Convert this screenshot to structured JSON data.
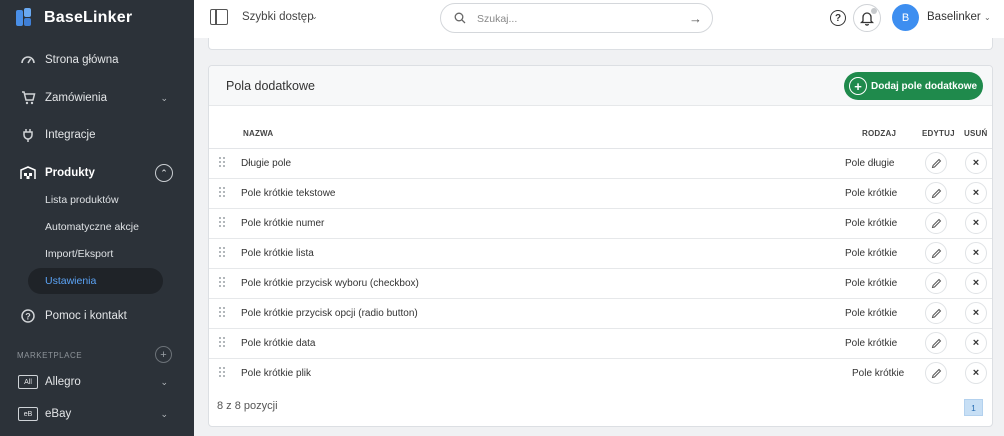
{
  "brand": {
    "name": "BaseLinker"
  },
  "sidebar": {
    "items": [
      {
        "label": "Strona główna",
        "icon": "dashboard-icon"
      },
      {
        "label": "Zamówienia",
        "icon": "cart-icon"
      },
      {
        "label": "Integracje",
        "icon": "plug-icon"
      },
      {
        "label": "Produkty",
        "icon": "warehouse-icon"
      },
      {
        "label": "Pomoc i kontakt",
        "icon": "help-icon"
      }
    ],
    "products_sub": [
      {
        "label": "Lista produktów"
      },
      {
        "label": "Automatyczne akcje"
      },
      {
        "label": "Import/Eksport"
      },
      {
        "label": "Ustawienia"
      }
    ],
    "marketplace_label": "MARKETPLACE",
    "marketplaces": [
      {
        "badge": "All",
        "label": "Allegro"
      },
      {
        "badge": "eB",
        "label": "eBay"
      }
    ]
  },
  "topbar": {
    "quick_access": "Szybki dostęp",
    "search_placeholder": "Szukaj...",
    "avatar_letter": "B",
    "user_name": "Baselinker"
  },
  "panel": {
    "title": "Pola dodatkowe",
    "add_button": "Dodaj pole dodatkowe",
    "columns": {
      "name": "NAZWA",
      "type": "RODZAJ",
      "edit": "EDYTUJ",
      "delete": "USUŃ"
    },
    "rows": [
      {
        "name": "Długie pole",
        "type": "Pole długie"
      },
      {
        "name": "Pole krótkie tekstowe",
        "type": "Pole krótkie"
      },
      {
        "name": "Pole krótkie numer",
        "type": "Pole krótkie"
      },
      {
        "name": "Pole krótkie lista",
        "type": "Pole krótkie"
      },
      {
        "name": "Pole krótkie przycisk wyboru (checkbox)",
        "type": "Pole krótkie"
      },
      {
        "name": "Pole krótkie przycisk opcji (radio button)",
        "type": "Pole krótkie"
      },
      {
        "name": "Pole krótkie data",
        "type": "Pole krótkie"
      },
      {
        "name": "Pole krótkie plik",
        "type": "Pole krótkie"
      }
    ],
    "count_text": "8 z 8 pozycji",
    "page": "1"
  },
  "colors": {
    "sidebar_bg": "#2c3239",
    "accent_green": "#1f8a4c",
    "accent_blue": "#3d8ef0",
    "active_link": "#5ba3f5"
  }
}
